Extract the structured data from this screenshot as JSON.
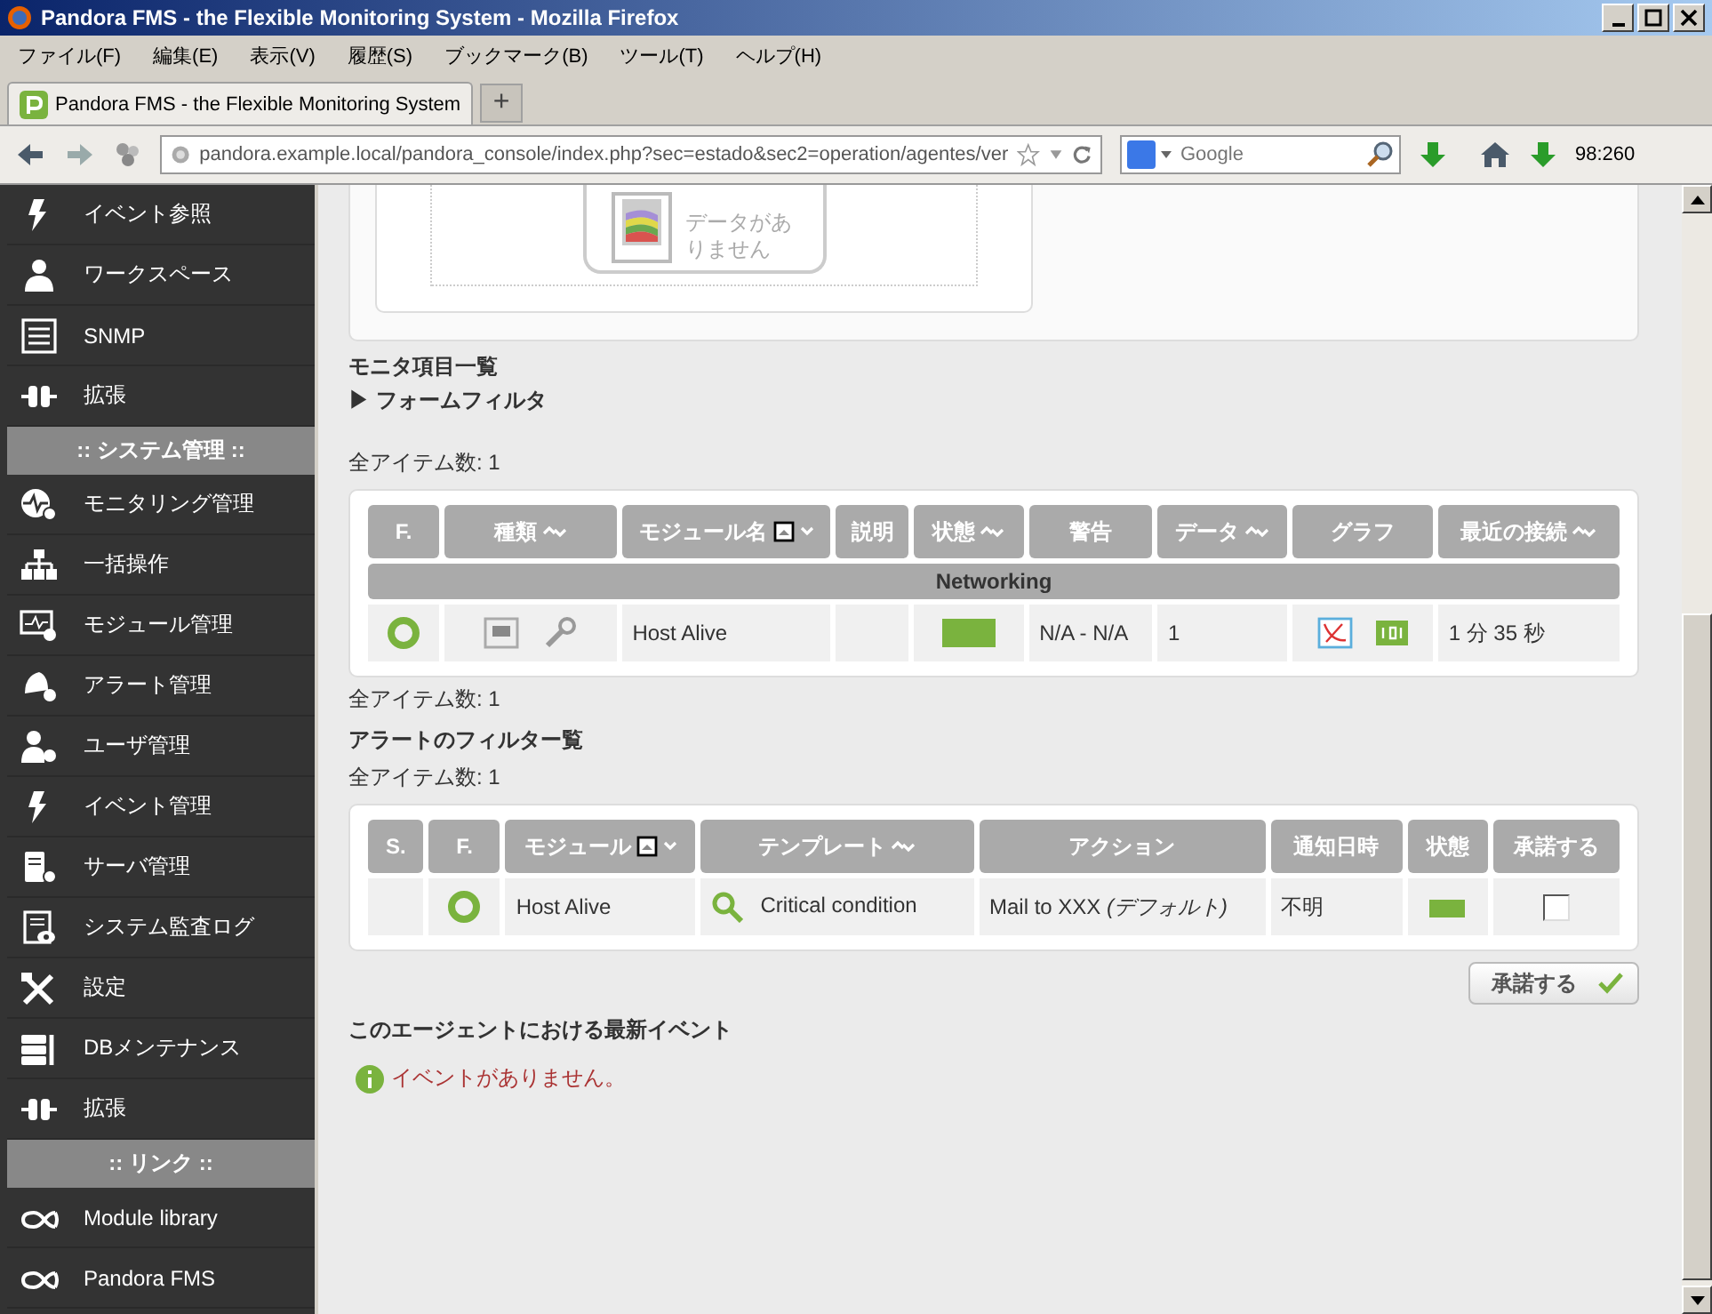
{
  "window": {
    "title": "Pandora FMS - the Flexible Monitoring System - Mozilla Firefox"
  },
  "menu": [
    "ファイル(F)",
    "編集(E)",
    "表示(V)",
    "履歴(S)",
    "ブックマーク(B)",
    "ツール(T)",
    "ヘルプ(H)"
  ],
  "tabs": [
    {
      "label": "Pandora FMS - the Flexible Monitoring System",
      "selected": true
    }
  ],
  "new_tab": "+",
  "address": {
    "url": "pandora.example.local/pandora_console/index.php?sec=estado&sec2=operation/agentes/ver"
  },
  "search": {
    "placeholder": "Google"
  },
  "download_status": "98:260",
  "sidebar": {
    "items": [
      {
        "kind": "item",
        "label": "イベント参照"
      },
      {
        "kind": "item",
        "label": "ワークスペース"
      },
      {
        "kind": "item",
        "label": "SNMP"
      },
      {
        "kind": "item",
        "label": "拡張"
      },
      {
        "kind": "header",
        "label": ":: システム管理 ::"
      },
      {
        "kind": "item",
        "label": "モニタリング管理"
      },
      {
        "kind": "item",
        "label": "一括操作"
      },
      {
        "kind": "item",
        "label": "モジュール管理"
      },
      {
        "kind": "item",
        "label": "アラート管理"
      },
      {
        "kind": "item",
        "label": "ユーザ管理"
      },
      {
        "kind": "item",
        "label": "イベント管理"
      },
      {
        "kind": "item",
        "label": "サーバ管理"
      },
      {
        "kind": "item",
        "label": "システム監査ログ"
      },
      {
        "kind": "item",
        "label": "設定"
      },
      {
        "kind": "item",
        "label": "DBメンテナンス"
      },
      {
        "kind": "item",
        "label": "拡張"
      },
      {
        "kind": "header",
        "label": ":: リンク ::"
      },
      {
        "kind": "item",
        "label": "Module library"
      },
      {
        "kind": "item",
        "label": "Pandora FMS"
      }
    ]
  },
  "graph_panel": {
    "message": "データがありません"
  },
  "modules": {
    "title": "モニタ項目一覧",
    "filter": "フォームフィルタ",
    "filter_marker": "▶",
    "count_top": "全アイテム数: 1",
    "count_bottom": "全アイテム数: 1",
    "columns": [
      {
        "label": "F.",
        "sortable": false,
        "sorted": false
      },
      {
        "label": "種類",
        "sortable": true,
        "sorted": false
      },
      {
        "label": "モジュール名",
        "sortable": true,
        "sorted": true
      },
      {
        "label": "説明",
        "sortable": false,
        "sorted": false
      },
      {
        "label": "状態",
        "sortable": true,
        "sorted": false
      },
      {
        "label": "警告",
        "sortable": false,
        "sorted": false
      },
      {
        "label": "データ",
        "sortable": true,
        "sorted": false
      },
      {
        "label": "グラフ",
        "sortable": false,
        "sorted": false
      },
      {
        "label": "最近の接続",
        "sortable": true,
        "sorted": false
      }
    ],
    "group": "Networking",
    "rows": [
      {
        "color": "#7ab33e",
        "name": "Host Alive",
        "warning": "N/A - N/A",
        "data": "1",
        "last_contact": "1 分 35 秒"
      }
    ]
  },
  "alerts": {
    "title": "アラートのフィルター覧",
    "count": "全アイテム数: 1",
    "columns": [
      {
        "label": "S.",
        "sortable": false,
        "sorted": false
      },
      {
        "label": "F.",
        "sortable": false,
        "sorted": false
      },
      {
        "label": "モジュール",
        "sortable": true,
        "sorted": true
      },
      {
        "label": "テンプレート",
        "sortable": true,
        "sorted": false
      },
      {
        "label": "アクション",
        "sortable": false,
        "sorted": false
      },
      {
        "label": "通知日時",
        "sortable": false,
        "sorted": false
      },
      {
        "label": "状態",
        "sortable": false,
        "sorted": false
      },
      {
        "label": "承諾する",
        "sortable": false,
        "sorted": false
      }
    ],
    "rows": [
      {
        "color": "#7ab33e",
        "module": "Host Alive",
        "template": "Critical condition",
        "action": "Mail to XXX *(デフォルト)*",
        "notified": "不明",
        "checked": false
      }
    ],
    "validate_button": "承諾する"
  },
  "events": {
    "title": "このエージェントにおける最新イベント",
    "message": "イベントがありません。"
  }
}
